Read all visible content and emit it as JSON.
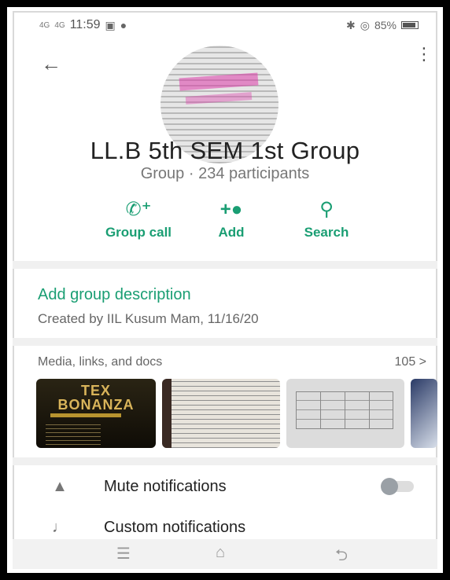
{
  "status_bar": {
    "signal_1": "4G",
    "signal_2": "4G",
    "time": "11:59",
    "right_info": "85%"
  },
  "header": {
    "group_name": "LL.B 5th SEM  1st Group",
    "subtitle": "Group · 234 participants"
  },
  "actions": {
    "call_label": "Group call",
    "add_label": "Add",
    "search_label": "Search"
  },
  "description": {
    "link_text": "Add group description",
    "created_text": "Created by IIL Kusum Mam, 11/16/20"
  },
  "media": {
    "title": "Media, links, and docs",
    "count": "105 >",
    "thumb1_text": "TEX BONANZA"
  },
  "settings": {
    "mute_label": "Mute notifications",
    "custom_label": "Custom notifications"
  },
  "colors": {
    "accent": "#1a9e73"
  }
}
